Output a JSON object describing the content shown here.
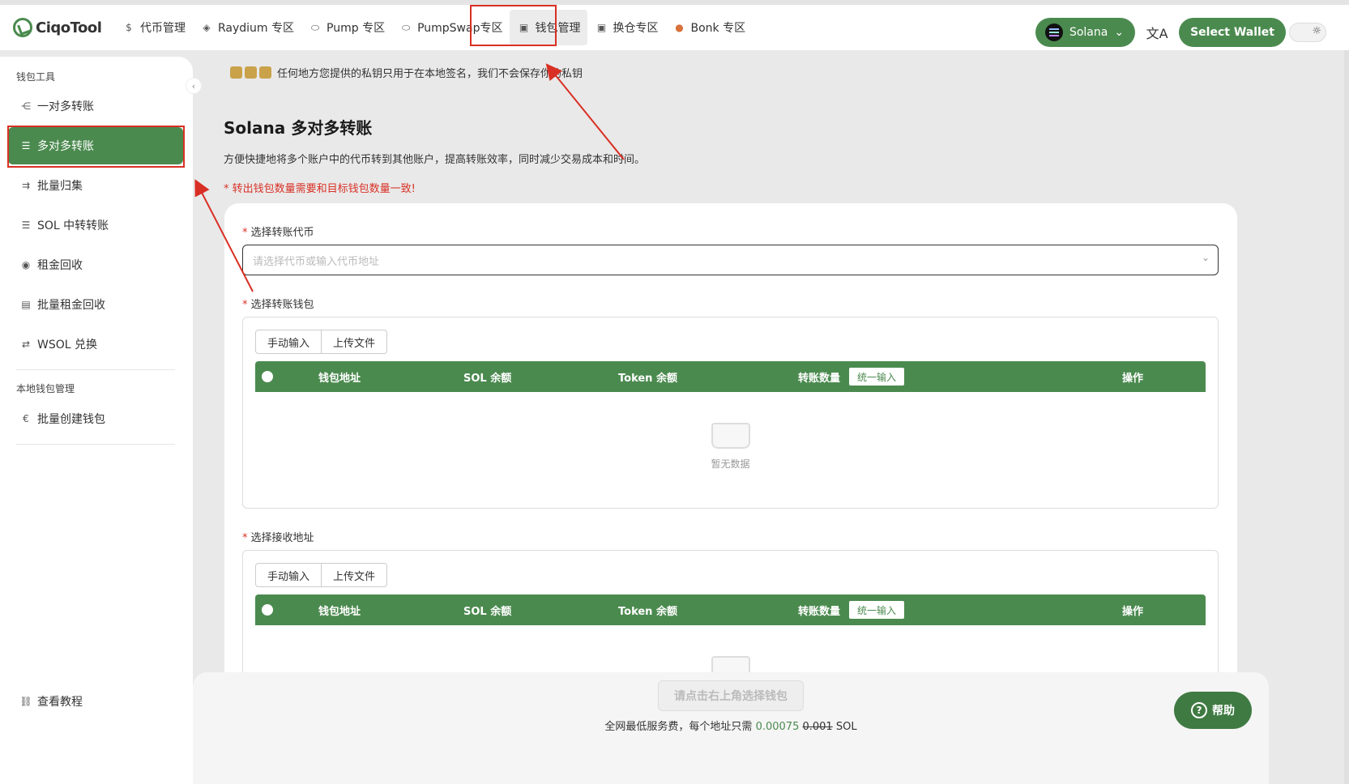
{
  "topbar": {
    "logo": "CiqoTool",
    "nav": [
      {
        "label": "代币管理",
        "icon": "dollar-icon"
      },
      {
        "label": "Raydium 专区",
        "icon": "raydium-icon"
      },
      {
        "label": "Pump 专区",
        "icon": "pill-icon"
      },
      {
        "label": "PumpSwap专区",
        "icon": "pill-icon"
      },
      {
        "label": "钱包管理",
        "icon": "wallet-icon"
      },
      {
        "label": "换仓专区",
        "icon": "wallet-icon"
      },
      {
        "label": "Bonk 专区",
        "icon": "bonk-icon"
      }
    ],
    "chain": "Solana",
    "select_wallet": "Select Wallet"
  },
  "sidebar": {
    "group1": "钱包工具",
    "items": [
      {
        "label": "一对多转账",
        "icon": "share-icon"
      },
      {
        "label": "多对多转账",
        "icon": "list-icon"
      },
      {
        "label": "批量归集",
        "icon": "merge-icon"
      },
      {
        "label": "SOL 中转转账",
        "icon": "list-icon"
      },
      {
        "label": "租金回收",
        "icon": "coin-icon"
      },
      {
        "label": "批量租金回收",
        "icon": "stack-icon"
      },
      {
        "label": "WSOL 兑换",
        "icon": "swap-icon"
      }
    ],
    "group2": "本地钱包管理",
    "items2": [
      {
        "label": "批量创建钱包",
        "icon": "euro-icon"
      }
    ],
    "tutorial": "查看教程"
  },
  "main": {
    "notice": "任何地方您提供的私钥只用于在本地签名，我们不会保存你的私钥",
    "title": "Solana 多对多转账",
    "desc": "方便快捷地将多个账户中的代币转到其他账户，提高转账效率，同时减少交易成本和时间。",
    "warn": "* 转出钱包数量需要和目标钱包数量一致!",
    "token_label": "选择转账代币",
    "token_placeholder": "请选择代币或输入代币地址",
    "from_label": "选择转账钱包",
    "to_label": "选择接收地址",
    "manual_input": "手动输入",
    "upload_file": "上传文件",
    "columns": {
      "address": "钱包地址",
      "sol": "SOL 余额",
      "token": "Token 余额",
      "amount": "转账数量",
      "unify": "统一输入",
      "action": "操作"
    },
    "empty": "暂无数据"
  },
  "footer": {
    "button": "请点击右上角选择钱包",
    "fee_prefix": "全网最低服务费，每个地址只需",
    "fee_price": "0.00075",
    "fee_old": "0.001",
    "fee_unit": "SOL"
  },
  "help": "帮助",
  "colors": {
    "accent": "#4b8a4f",
    "highlight": "#d93025"
  }
}
